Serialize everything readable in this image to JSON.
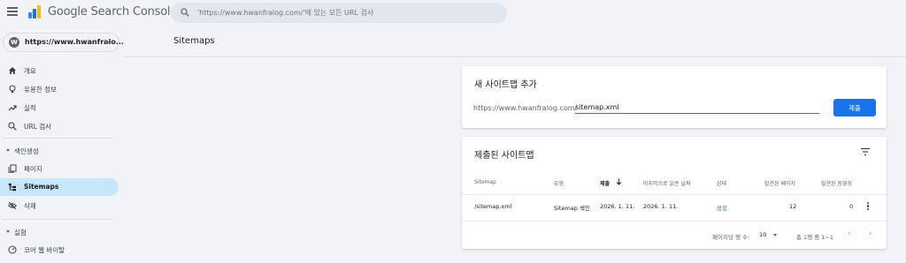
{
  "app": {
    "title": "Google Search Console"
  },
  "search": {
    "placeholder": "'https://www.hwanfralog.com/'에 있는 모든 URL 검사"
  },
  "property": {
    "label": "https://www.hwanfralo..."
  },
  "sidebar": {
    "items": [
      {
        "label": "개요",
        "icon": "home-icon"
      },
      {
        "label": "유용한 정보",
        "icon": "lightbulb-icon"
      },
      {
        "label": "실적",
        "icon": "trending-up-icon"
      },
      {
        "label": "URL 검사",
        "icon": "search-icon"
      }
    ],
    "sections": [
      {
        "label": "색인생성"
      },
      {
        "label": "실험"
      }
    ],
    "index_items": [
      {
        "label": "페이지",
        "icon": "pages-icon"
      },
      {
        "label": "Sitemaps",
        "icon": "sitemap-icon",
        "active": true
      },
      {
        "label": "삭제",
        "icon": "visibility-off-icon"
      }
    ],
    "experiment_items": [
      {
        "label": "코어 웹 바이탈",
        "icon": "speed-gauge-icon"
      }
    ]
  },
  "main": {
    "page_title": "Sitemaps"
  },
  "add_sitemap": {
    "title": "새 사이트맵 추가",
    "url_prefix": "https://www.hwanfralog.com/",
    "input_value": "sitemap.xml",
    "submit_label": "제출"
  },
  "submitted": {
    "title": "제출된 사이트맵",
    "columns": [
      "Sitemap",
      "유형",
      "제출",
      "마지막으로 읽은 날짜",
      "상태",
      "발견된 페이지",
      "발견된 동영상"
    ],
    "rows": [
      {
        "sitemap": "/sitemap.xml",
        "type": "Sitemap 색인",
        "submitted": "2026. 1. 11.",
        "last_read": "2026. 1. 11.",
        "status": "성공",
        "pages": "12",
        "videos": "0"
      }
    ],
    "footer": {
      "rows_per_page_label": "페이지당 행 수:",
      "rows_per_page": "10",
      "range": "총 1행 중 1~1"
    }
  },
  "colors": {
    "accent": "#1a73e8",
    "active_nav": "#c8e6fa",
    "success": "#188038",
    "background": "#f1f3f6"
  }
}
